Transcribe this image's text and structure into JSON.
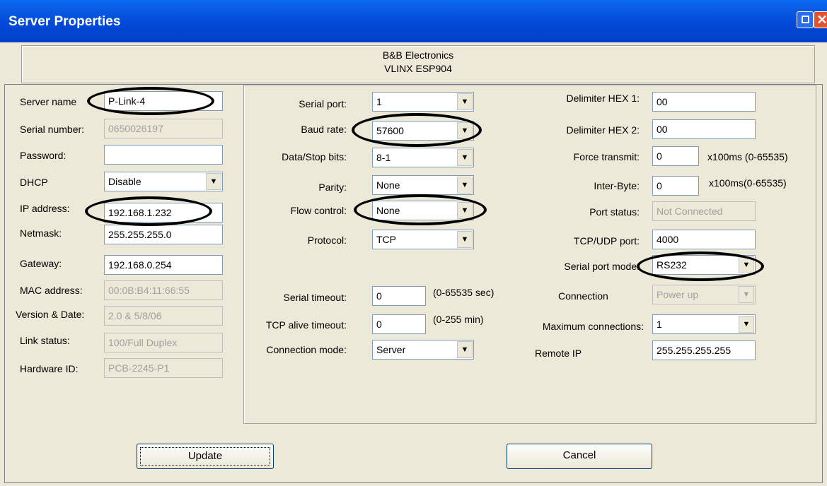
{
  "window": {
    "title": "Server Properties"
  },
  "header": {
    "line1": "B&B Electronics",
    "line2": "VLINX ESP904"
  },
  "left": {
    "server_name": {
      "label": "Server name",
      "value": "P-Link-4"
    },
    "serial_number": {
      "label": "Serial number:",
      "value": "0650026197"
    },
    "password": {
      "label": "Password:",
      "value": ""
    },
    "dhcp": {
      "label": "DHCP",
      "value": "Disable"
    },
    "ip_address": {
      "label": "IP address:",
      "value": "192.168.1.232"
    },
    "netmask": {
      "label": "Netmask:",
      "value": "255.255.255.0"
    },
    "gateway": {
      "label": "Gateway:",
      "value": "192.168.0.254"
    },
    "mac_address": {
      "label": "MAC address:",
      "value": "00:0B:B4:11:66:55"
    },
    "version_date": {
      "label": "Version & Date:",
      "value": "2.0 & 5/8/06"
    },
    "link_status": {
      "label": "Link status:",
      "value": "100/Full Duplex"
    },
    "hardware_id": {
      "label": "Hardware ID:",
      "value": "PCB-2245-P1"
    }
  },
  "mid": {
    "serial_port": {
      "label": "Serial port:",
      "value": "1"
    },
    "baud_rate": {
      "label": "Baud rate:",
      "value": "57600"
    },
    "data_stop_bits": {
      "label": "Data/Stop bits:",
      "value": "8-1"
    },
    "parity": {
      "label": "Parity:",
      "value": "None"
    },
    "flow_control": {
      "label": "Flow control:",
      "value": "None"
    },
    "protocol": {
      "label": "Protocol:",
      "value": "TCP"
    },
    "serial_timeout": {
      "label": "Serial timeout:",
      "value": "0",
      "hint": "(0-65535 sec)"
    },
    "tcp_alive_timeout": {
      "label": "TCP alive timeout:",
      "value": "0",
      "hint": "(0-255 min)"
    },
    "connection_mode": {
      "label": "Connection mode:",
      "value": "Server"
    }
  },
  "right": {
    "delimiter_hex1": {
      "label": "Delimiter HEX 1:",
      "value": "00"
    },
    "delimiter_hex2": {
      "label": "Delimiter HEX 2:",
      "value": "00"
    },
    "force_transmit": {
      "label": "Force transmit:",
      "value": "0",
      "hint": "x100ms (0-65535)"
    },
    "inter_byte": {
      "label": "Inter-Byte:",
      "value": "0",
      "hint": "x100ms(0-65535)"
    },
    "port_status": {
      "label": "Port status:",
      "value": "Not Connected"
    },
    "tcp_udp_port": {
      "label": "TCP/UDP port:",
      "value": "4000"
    },
    "serial_port_mode": {
      "label": "Serial port mode:",
      "value": "RS232"
    },
    "connection": {
      "label": "Connection",
      "value": "Power up"
    },
    "max_connections": {
      "label": "Maximum connections:",
      "value": "1"
    },
    "remote_ip": {
      "label": "Remote IP",
      "value": "255.255.255.255"
    }
  },
  "buttons": {
    "update": "Update",
    "cancel": "Cancel"
  },
  "icons": {
    "restore": "restore-icon",
    "close": "close-icon",
    "dropdown": "dropdown-arrow-icon"
  }
}
